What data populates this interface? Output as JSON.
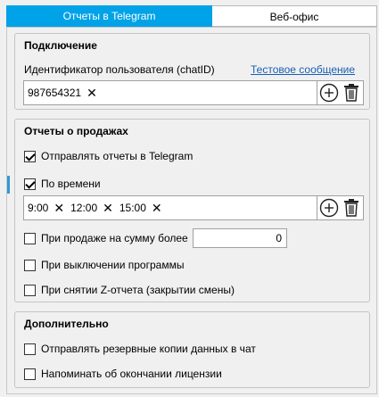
{
  "tabs": [
    {
      "label": "Отчеты в Telegram",
      "active": true
    },
    {
      "label": "Веб-офис",
      "active": false
    }
  ],
  "connection": {
    "title": "Подключение",
    "user_id_label": "Идентификатор пользователя (chatID)",
    "test_link": "Тестовое сообщение",
    "chat_ids": [
      "987654321"
    ]
  },
  "sales_reports": {
    "title": "Отчеты о продажах",
    "send_reports": {
      "label": "Отправлять отчеты в Telegram",
      "checked": true
    },
    "by_time": {
      "label": "По времени",
      "checked": true
    },
    "times": [
      "9:00",
      "12:00",
      "15:00"
    ],
    "sum_over": {
      "label": "При продаже на сумму более",
      "checked": false,
      "value": "0"
    },
    "on_shutdown": {
      "label": "При выключении программы",
      "checked": false
    },
    "on_z_report": {
      "label": "При снятии Z-отчета (закрытии смены)",
      "checked": false
    }
  },
  "additional": {
    "title": "Дополнительно",
    "backup": {
      "label": "Отправлять резервные копии данных в чат",
      "checked": false
    },
    "license": {
      "label": "Напоминать об окончании лицензии",
      "checked": false
    }
  },
  "colors": {
    "accent": "#00a2e8",
    "link": "#1a5fb4"
  },
  "icons": [
    "plus-circle-icon",
    "trash-icon",
    "close-icon",
    "checkmark-icon"
  ]
}
